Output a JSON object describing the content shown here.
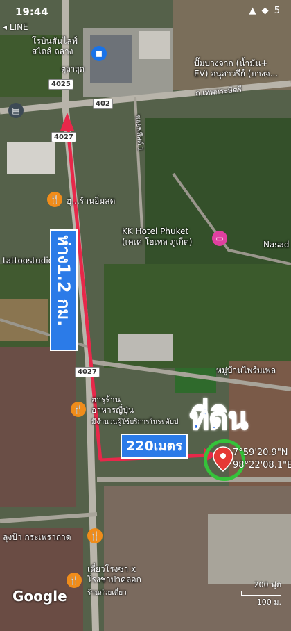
{
  "status": {
    "time": "19:44",
    "icons": "▲ ◆ 5",
    "back_label": "◂ LINE"
  },
  "labels": {
    "top_mall": "โรบินสันไลฟ์\nสไตล์ ถลาง",
    "top_mall_sub": "ตุลาสุด",
    "fuel_station": "ปั๊มบางจาก (น้ำมัน+\nEV) อนุสาวรีย์ (บางจ...",
    "road_top": "ถ.เทพกระษัตรี",
    "vertical_road": "ซอยพลีสต์ 1",
    "restaurant_1": "ฮุ...ร้านอิ่มสด",
    "kk_hotel": "KK Hotel Phuket\n(เคเค โฮเทล ภูเก็ต)",
    "nasad": "Nasad 1",
    "tattoo": "tattoostudiohkt",
    "village": "หมู่บ้านไพร์มเพล",
    "japanese": "ฮารุร้าน\nอาหารญี่ปุ่น",
    "japanese_sub": "มีจำนวนผู้ใช้บริการในระดับป",
    "lung_pa": "ลุงป้า กระเพราถาด",
    "noodle": "เตี๋ยวโรงซา x\nโรงชาป่าคลอก",
    "noodle_sub": "ร้านก๋วยเตี๋ยว"
  },
  "roads": {
    "r4025": "4025",
    "r402": "402",
    "r4027a": "4027",
    "r4027b": "4027"
  },
  "annotations": {
    "land": "ที่ดิน",
    "distance_short": "220เมตร",
    "distance_long": "ห่าง1.2 กม."
  },
  "coords": {
    "lat": "7°59'20.9\"N",
    "lng": "98°22'08.1\"E"
  },
  "brand": "Google",
  "scale": {
    "ft": "200 ฟุต",
    "m": "100 ม."
  },
  "colors": {
    "arrow": "#e8284a",
    "accent": "#2b7be8",
    "ring": "#35c23a",
    "pin": "#e53935"
  }
}
